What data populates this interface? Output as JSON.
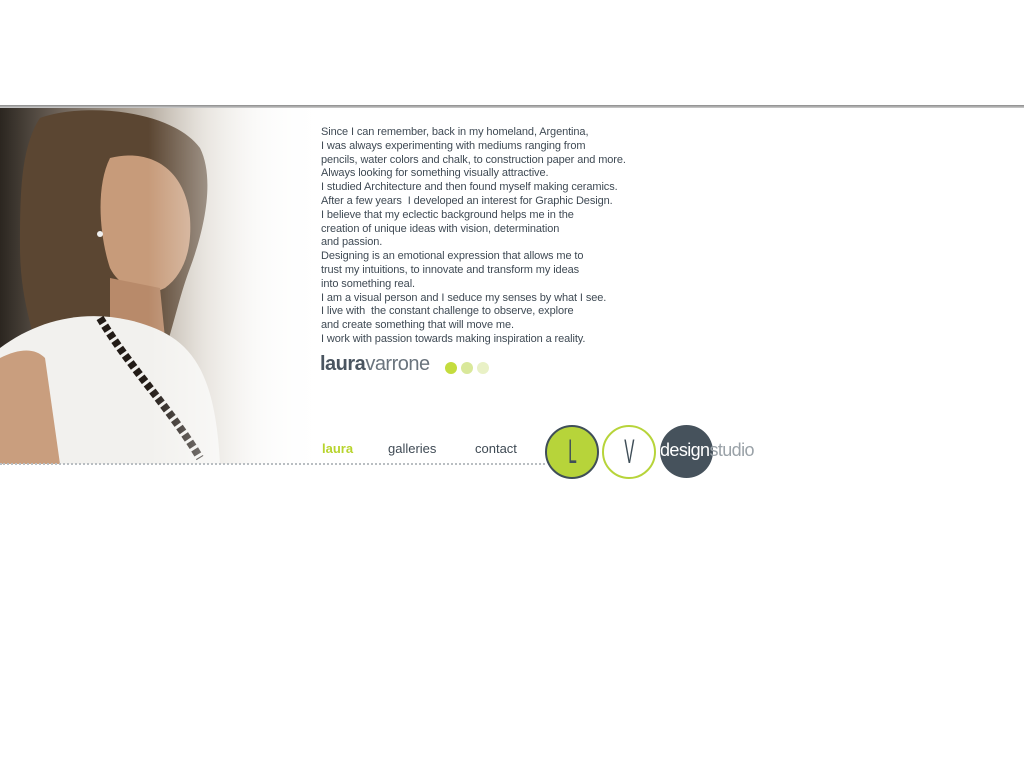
{
  "bio": {
    "lines": [
      "Since I can remember, back in my homeland, Argentina,",
      "I was always experimenting with mediums ranging from",
      "pencils, water colors and chalk, to construction paper and more.",
      "Always looking for something visually attractive.",
      "I studied Architecture and then found myself making ceramics.",
      "After a few years  I developed an interest for Graphic Design.",
      "I believe that my eclectic background helps me in the",
      "creation of unique ideas with vision, determination",
      "and passion.",
      "Designing is an emotional expression that allows me to",
      "trust my intuitions, to innovate and transform my ideas",
      "into something real.",
      "I am a visual person and I seduce my senses by what I see.",
      "I live with  the constant challenge to observe, explore",
      "and create something that will move me.",
      "I work with passion towards making inspiration a reality."
    ]
  },
  "signature": {
    "first": "laura",
    "last": "varrone"
  },
  "nav": {
    "items": [
      {
        "label": "laura",
        "active": true
      },
      {
        "label": "galleries",
        "active": false
      },
      {
        "label": "contact",
        "active": false
      }
    ]
  },
  "logo": {
    "letter_l": "L",
    "letter_v": "V",
    "word_a": "design",
    "word_b": "studio"
  },
  "colors": {
    "accent": "#b7d43a",
    "dark": "#46525c",
    "text": "#3f4a54",
    "dot_colors": [
      "#c4dc3e",
      "#d9e89a",
      "#e9f1c6"
    ]
  },
  "icons": [
    "decorative-dots",
    "portrait-photo"
  ]
}
